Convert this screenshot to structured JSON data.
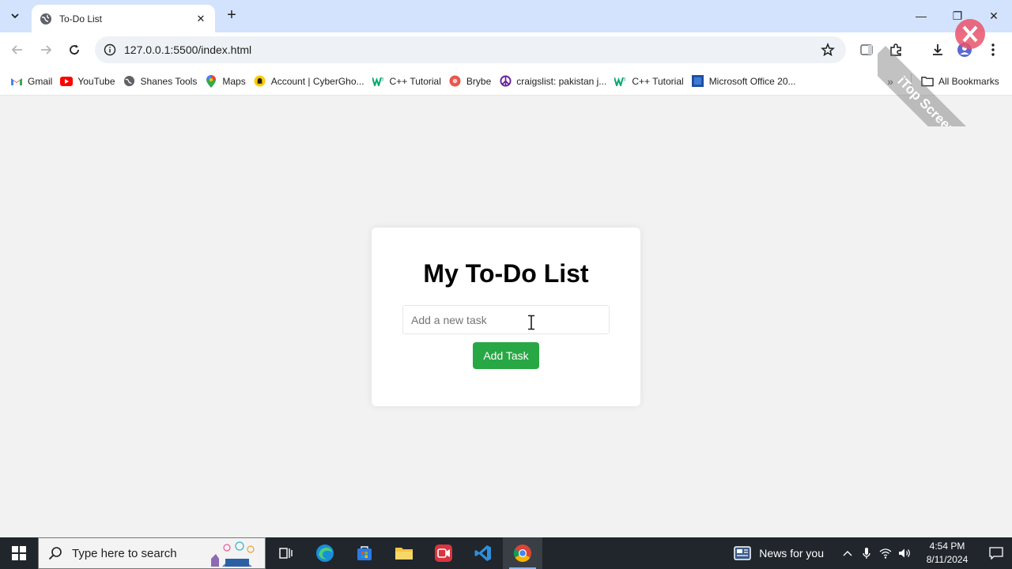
{
  "browser": {
    "tab": {
      "title": "To-Do List"
    },
    "address": {
      "url": "127.0.0.1:5500/index.html"
    },
    "bookmarks": [
      {
        "label": "Gmail",
        "icon": "gmail-icon"
      },
      {
        "label": "YouTube",
        "icon": "youtube-icon"
      },
      {
        "label": "Shanes Tools",
        "icon": "globe-icon"
      },
      {
        "label": "Maps",
        "icon": "maps-icon"
      },
      {
        "label": "Account | CyberGho...",
        "icon": "cyberghost-icon"
      },
      {
        "label": "C++ Tutorial",
        "icon": "w3schools-icon"
      },
      {
        "label": "Brybe",
        "icon": "brybe-icon"
      },
      {
        "label": "craigslist: pakistan j...",
        "icon": "peace-icon"
      },
      {
        "label": "C++ Tutorial",
        "icon": "w3schools-icon"
      },
      {
        "label": "Microsoft Office 20...",
        "icon": "office-icon"
      }
    ],
    "all_bookmarks": "All Bookmarks"
  },
  "page": {
    "heading": "My To-Do List",
    "input_placeholder": "Add a new task",
    "add_button": "Add Task",
    "accent_color": "#28a745"
  },
  "watermark": {
    "text": "iTop Screen Recorder"
  },
  "taskbar": {
    "search_placeholder": "Type here to search",
    "news": "News for you",
    "time": "4:54 PM",
    "date": "8/11/2024"
  }
}
